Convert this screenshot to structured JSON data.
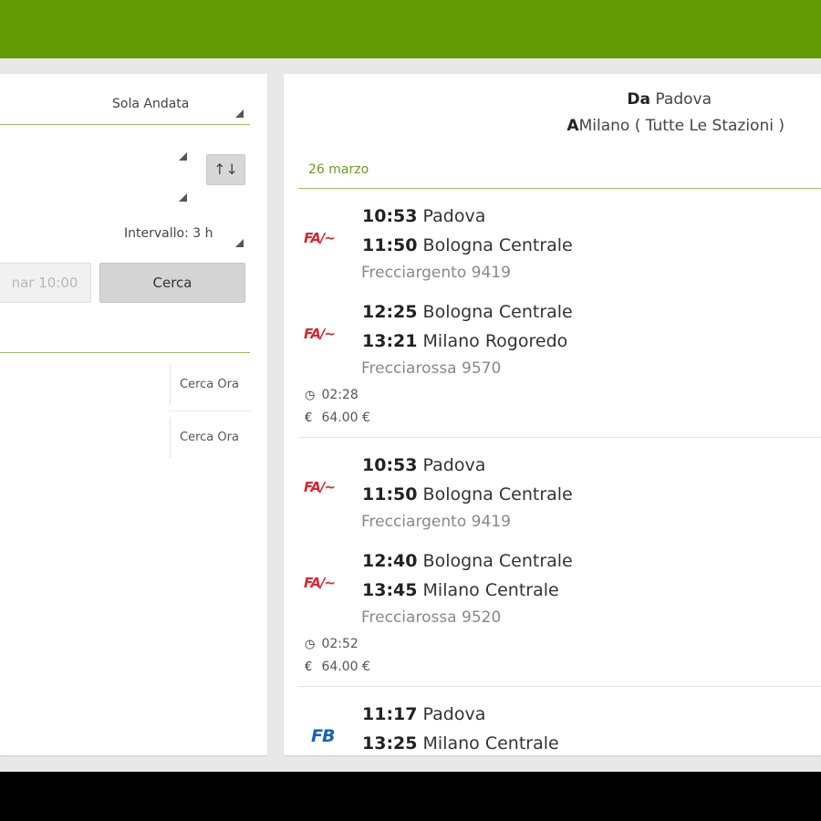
{
  "colors": {
    "action_bar": "#629a06",
    "accent_line": "#9bbf5e",
    "date": "#6a9a2a",
    "freccia_red": "#d7262f",
    "fb_blue": "#1765b8"
  },
  "search": {
    "trip_type": "Sola Andata",
    "interval": "Intervallo: 3 h",
    "swap_icon": "↑↓",
    "return_button": "nar 10:00",
    "search_button": "Cerca",
    "history": [
      {
        "action": "Cerca Ora"
      },
      {
        "action": "Cerca Ora"
      }
    ]
  },
  "results": {
    "from_label": "Da",
    "from": "Padova",
    "to_label": "A",
    "to": "Milano ( Tutte Le Stazioni )",
    "date": "26 marzo",
    "solutions": [
      {
        "legs": [
          {
            "logo": "FA",
            "dep_time": "10:53",
            "dep_station": "Padova",
            "arr_time": "11:50",
            "arr_station": "Bologna Centrale",
            "train": "Frecciargento 9419"
          },
          {
            "logo": "FR",
            "dep_time": "12:25",
            "dep_station": "Bologna Centrale",
            "arr_time": "13:21",
            "arr_station": "Milano Rogoredo",
            "train": "Frecciarossa 9570"
          }
        ],
        "duration": "02:28",
        "price": "64.00 €"
      },
      {
        "legs": [
          {
            "logo": "FA",
            "dep_time": "10:53",
            "dep_station": "Padova",
            "arr_time": "11:50",
            "arr_station": "Bologna Centrale",
            "train": "Frecciargento 9419"
          },
          {
            "logo": "FR",
            "dep_time": "12:40",
            "dep_station": "Bologna Centrale",
            "arr_time": "13:45",
            "arr_station": "Milano Centrale",
            "train": "Frecciarossa 9520"
          }
        ],
        "duration": "02:52",
        "price": "64.00 €"
      },
      {
        "legs": [
          {
            "logo": "FB",
            "dep_time": "11:17",
            "dep_station": "Padova",
            "arr_time": "13:25",
            "arr_station": "Milano Centrale"
          }
        ]
      }
    ]
  }
}
